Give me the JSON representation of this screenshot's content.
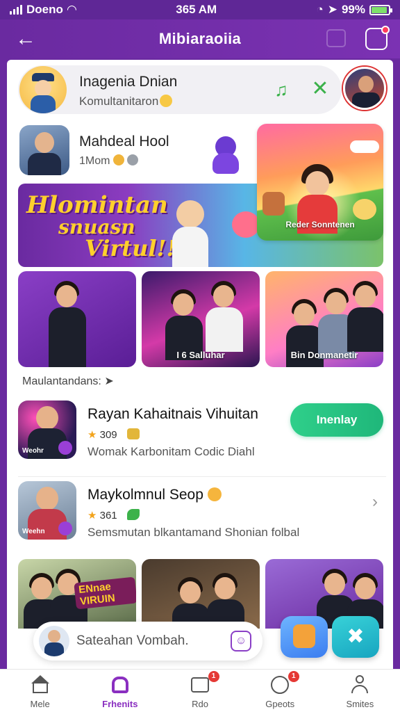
{
  "status_bar": {
    "carrier": "Doeno",
    "time": "365 AM",
    "battery": "99%"
  },
  "header": {
    "title": "Mibiaraoiia",
    "back_icon": "arrow-left-icon",
    "notification_icon": "bell-square-icon"
  },
  "profile": {
    "name": "Inagenia Dnian",
    "subtitle": "Komultanitaron"
  },
  "creator": {
    "name": "Mahdeal Hool",
    "subtitle": "1Mom"
  },
  "hero": {
    "line1": "Hlomintan",
    "line2": "snuasn",
    "line3": "Virtul!!"
  },
  "concert": {
    "caption": "Reder Sonntenen"
  },
  "thumbs": [
    {
      "caption": ""
    },
    {
      "caption": "I 6 Salluhar"
    },
    {
      "caption": "Bin Donmanetir"
    }
  ],
  "section_label": "Maulantandans:",
  "list": [
    {
      "title": "Rayan Kahaitnais Vihuitan",
      "rating": "309",
      "description": "Womak Karbonitam Codic Diahl",
      "thumb_tag": "Weohr",
      "action_label": "Inenlay"
    },
    {
      "title": "Maykolmnul Seop",
      "rating": "361",
      "description": "Semsmutan blkantamand Shonian folbal",
      "thumb_tag": "Weehn"
    }
  ],
  "bottom_thumbs": [
    {
      "sign": "ENnae VIRUIN"
    }
  ],
  "search": {
    "placeholder": "Sateahan Vombah."
  },
  "nav": [
    {
      "label": "Mele",
      "icon": "home-icon"
    },
    {
      "label": "Frhenits",
      "icon": "favorites-icon",
      "active": true
    },
    {
      "label": "Rdo",
      "icon": "box-icon",
      "badge": "1"
    },
    {
      "label": "Gpeots",
      "icon": "cookie-icon",
      "badge": "1"
    },
    {
      "label": "Smites",
      "icon": "user-icon"
    }
  ],
  "colors": {
    "brand": "#6a2aa0",
    "accent_green": "#1fb77a",
    "nav_active": "#8a2fc0"
  }
}
